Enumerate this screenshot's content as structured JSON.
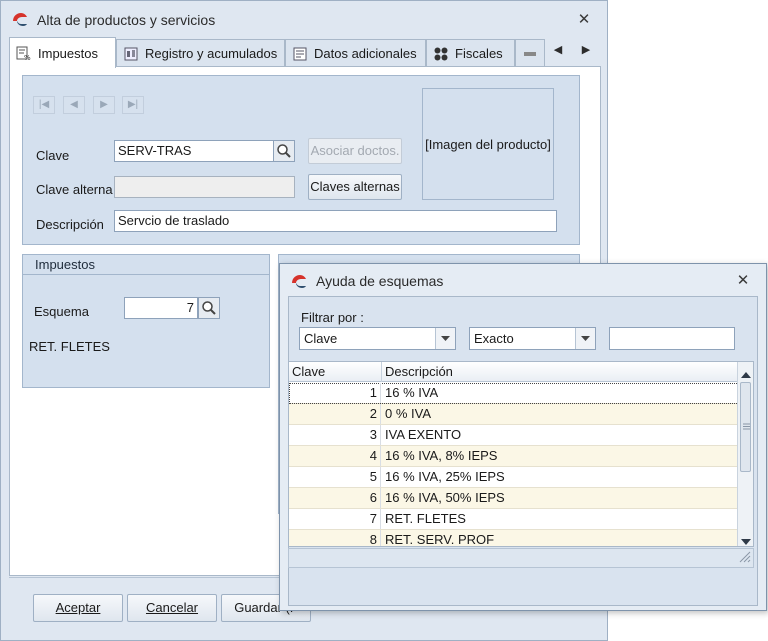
{
  "main_window": {
    "title": "Alta de productos y servicios",
    "close_glyph": "✕",
    "tabs": [
      {
        "label": "Impuestos",
        "icon": "tax-icon",
        "active": true
      },
      {
        "label": "Registro y acumulados",
        "icon": "registry-icon",
        "active": false
      },
      {
        "label": "Datos adicionales",
        "icon": "additional-data-icon",
        "active": false
      },
      {
        "label": "Fiscales",
        "icon": "fiscal-icon",
        "active": false
      }
    ],
    "tab_scroll": {
      "left": "◀",
      "right": "▶"
    },
    "nav_buttons": [
      "|◀",
      "◀",
      "▶",
      "▶|"
    ],
    "clave_label": "Clave",
    "clave_value": "SERV-TRAS",
    "asociar_button": "Asociar doctos.",
    "clave_alterna_label": "Clave alterna",
    "clave_alterna_value": "",
    "claves_alternas_button": "Claves alternas",
    "descripcion_label": "Descripción",
    "descripcion_value": "Servcio de traslado",
    "image_placeholder": "[Imagen del producto]",
    "impuestos_group": {
      "title": "Impuestos",
      "esquema_label": "Esquema",
      "esquema_value": "7",
      "esquema_name": "RET. FLETES"
    },
    "bottom_buttons": {
      "aceptar": "Aceptar",
      "cancelar": "Cancelar",
      "guardar": "Guardar (F"
    }
  },
  "dialog": {
    "title": "Ayuda de esquemas",
    "close_glyph": "✕",
    "filter_label": "Filtrar por :",
    "filter_field": "Clave",
    "filter_mode": "Exacto",
    "filter_text": "",
    "columns": [
      "Clave",
      "Descripción"
    ],
    "rows": [
      {
        "clave": "1",
        "descripcion": "16 % IVA"
      },
      {
        "clave": "2",
        "descripcion": "0 % IVA"
      },
      {
        "clave": "3",
        "descripcion": "IVA EXENTO"
      },
      {
        "clave": "4",
        "descripcion": "16 % IVA, 8% IEPS"
      },
      {
        "clave": "5",
        "descripcion": "16 % IVA, 25% IEPS"
      },
      {
        "clave": "6",
        "descripcion": "16 % IVA, 50% IEPS"
      },
      {
        "clave": "7",
        "descripcion": "RET. FLETES"
      },
      {
        "clave": "8",
        "descripcion": "RET. SERV. PROF"
      }
    ],
    "selected_row": 0
  },
  "colors": {
    "window_bg": "#dfe7f1",
    "panel_bg": "#d4e0ee",
    "row_alt": "#fbf7e6",
    "app_icon_red": "#d6332b"
  }
}
